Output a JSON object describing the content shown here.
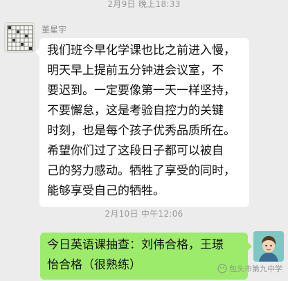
{
  "timestamps": {
    "first": "2月9日 晚上18:33",
    "second": "2月10日 中午12:06"
  },
  "messages": [
    {
      "sender": "董星宇",
      "side": "left",
      "lines": [
        "我们班今早化学课也比之前进入慢，",
        "明天早上提前五分钟进会议室，不",
        "要迟到。一定要像第一天一样坚持，",
        "不要懈怠，这是考验自控力的关键",
        "时刻，也是每个孩子优秀品质所在。",
        "希望你们过了这段日子都可以被自",
        "己的努力感动。牺牲了享受的同时，",
        "能够享受自己的牺牲。"
      ]
    },
    {
      "side": "right",
      "lines": [
        "今日英语课抽查：刘伟合格，王璟",
        "怡合格（很熟练）"
      ]
    }
  ],
  "watermark": {
    "text": "包头市第九中学",
    "icon": "wechat-channel-icon"
  },
  "colors": {
    "background": "#ececec",
    "bubble_received": "#ffffff",
    "bubble_sent": "#9deb6a"
  }
}
